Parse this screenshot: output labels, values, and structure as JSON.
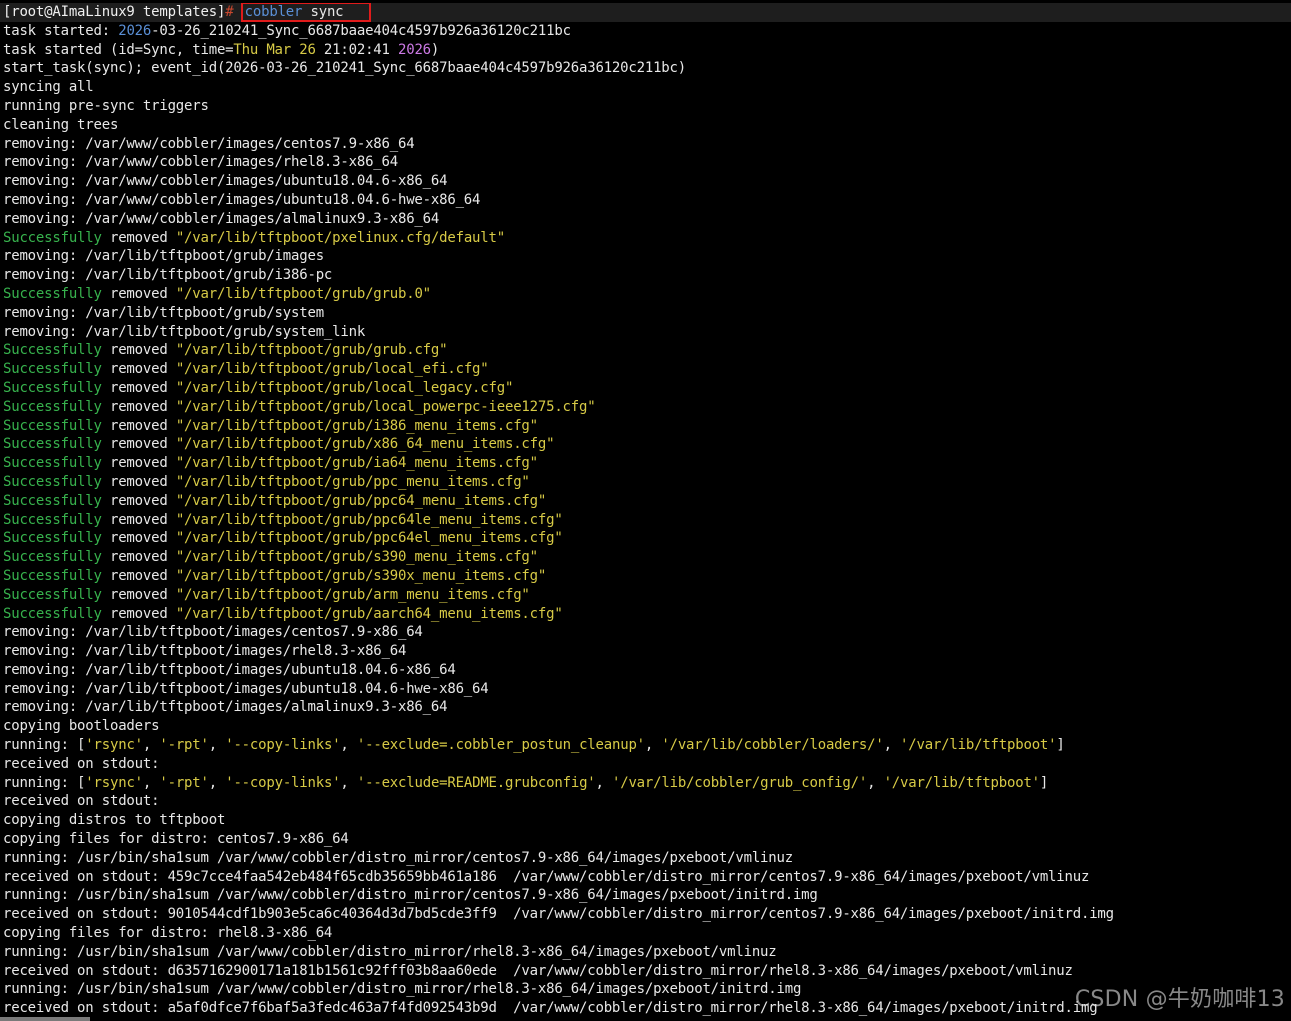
{
  "terminal": {
    "lines": [
      [
        {
          "t": "[root@AImaLinux9 templates]",
          "c": "p"
        },
        {
          "t": "# ",
          "c": "r"
        },
        {
          "t": "cobbler",
          "c": "b",
          "box": true
        },
        {
          "t": " sync",
          "c": "w",
          "box": true
        }
      ],
      [
        {
          "t": "task started",
          "c": "w"
        },
        {
          "t": ": ",
          "c": "w"
        },
        {
          "t": "2026",
          "c": "b"
        },
        {
          "t": "-03-26_210241_Sync_6687baae404c4597b926a36120c211bc",
          "c": "w"
        }
      ],
      [
        {
          "t": "task started (id=Sync, time=",
          "c": "w"
        },
        {
          "t": "Thu Mar 26",
          "c": "y"
        },
        {
          "t": " 21:02:41 ",
          "c": "w"
        },
        {
          "t": "2026",
          "c": "v"
        },
        {
          "t": ")",
          "c": "w"
        }
      ],
      [
        {
          "t": "start_task(sync); event_id(2026-03-26_210241_Sync_6687baae404c4597b926a36120c211bc)",
          "c": "w"
        }
      ],
      [
        {
          "t": "syncing all",
          "c": "w"
        }
      ],
      [
        {
          "t": "running pre-sync triggers",
          "c": "w"
        }
      ],
      [
        {
          "t": "cleaning trees",
          "c": "w"
        }
      ],
      [
        {
          "t": "removing: /var/www/cobbler/images/centos7.9-x86_64",
          "c": "w"
        }
      ],
      [
        {
          "t": "removing: /var/www/cobbler/images/rhel8.3-x86_64",
          "c": "w"
        }
      ],
      [
        {
          "t": "removing: /var/www/cobbler/images/ubuntu18.04.6-x86_64",
          "c": "w"
        }
      ],
      [
        {
          "t": "removing: /var/www/cobbler/images/ubuntu18.04.6-hwe-x86_64",
          "c": "w"
        }
      ],
      [
        {
          "t": "removing: /var/www/cobbler/images/almalinux9.3-x86_64",
          "c": "w"
        }
      ],
      [
        {
          "t": "Successfully",
          "c": "g"
        },
        {
          "t": " removed ",
          "c": "w"
        },
        {
          "t": "\"/var/lib/tftpboot/pxelinux.cfg/default\"",
          "c": "y"
        }
      ],
      [
        {
          "t": "removing: /var/lib/tftpboot/grub/images",
          "c": "w"
        }
      ],
      [
        {
          "t": "removing: /var/lib/tftpboot/grub/i386-pc",
          "c": "w"
        }
      ],
      [
        {
          "t": "Successfully",
          "c": "g"
        },
        {
          "t": " removed ",
          "c": "w"
        },
        {
          "t": "\"/var/lib/tftpboot/grub/grub.0\"",
          "c": "y"
        }
      ],
      [
        {
          "t": "removing: /var/lib/tftpboot/grub/system",
          "c": "w"
        }
      ],
      [
        {
          "t": "removing: /var/lib/tftpboot/grub/system_link",
          "c": "w"
        }
      ],
      [
        {
          "t": "Successfully",
          "c": "g"
        },
        {
          "t": " removed ",
          "c": "w"
        },
        {
          "t": "\"/var/lib/tftpboot/grub/grub.cfg\"",
          "c": "y"
        }
      ],
      [
        {
          "t": "Successfully",
          "c": "g"
        },
        {
          "t": " removed ",
          "c": "w"
        },
        {
          "t": "\"/var/lib/tftpboot/grub/local_efi.cfg\"",
          "c": "y"
        }
      ],
      [
        {
          "t": "Successfully",
          "c": "g"
        },
        {
          "t": " removed ",
          "c": "w"
        },
        {
          "t": "\"/var/lib/tftpboot/grub/local_legacy.cfg\"",
          "c": "y"
        }
      ],
      [
        {
          "t": "Successfully",
          "c": "g"
        },
        {
          "t": " removed ",
          "c": "w"
        },
        {
          "t": "\"/var/lib/tftpboot/grub/local_powerpc-ieee1275.cfg\"",
          "c": "y"
        }
      ],
      [
        {
          "t": "Successfully",
          "c": "g"
        },
        {
          "t": " removed ",
          "c": "w"
        },
        {
          "t": "\"/var/lib/tftpboot/grub/i386_menu_items.cfg\"",
          "c": "y"
        }
      ],
      [
        {
          "t": "Successfully",
          "c": "g"
        },
        {
          "t": " removed ",
          "c": "w"
        },
        {
          "t": "\"/var/lib/tftpboot/grub/x86_64_menu_items.cfg\"",
          "c": "y"
        }
      ],
      [
        {
          "t": "Successfully",
          "c": "g"
        },
        {
          "t": " removed ",
          "c": "w"
        },
        {
          "t": "\"/var/lib/tftpboot/grub/ia64_menu_items.cfg\"",
          "c": "y"
        }
      ],
      [
        {
          "t": "Successfully",
          "c": "g"
        },
        {
          "t": " removed ",
          "c": "w"
        },
        {
          "t": "\"/var/lib/tftpboot/grub/ppc_menu_items.cfg\"",
          "c": "y"
        }
      ],
      [
        {
          "t": "Successfully",
          "c": "g"
        },
        {
          "t": " removed ",
          "c": "w"
        },
        {
          "t": "\"/var/lib/tftpboot/grub/ppc64_menu_items.cfg\"",
          "c": "y"
        }
      ],
      [
        {
          "t": "Successfully",
          "c": "g"
        },
        {
          "t": " removed ",
          "c": "w"
        },
        {
          "t": "\"/var/lib/tftpboot/grub/ppc64le_menu_items.cfg\"",
          "c": "y"
        }
      ],
      [
        {
          "t": "Successfully",
          "c": "g"
        },
        {
          "t": " removed ",
          "c": "w"
        },
        {
          "t": "\"/var/lib/tftpboot/grub/ppc64el_menu_items.cfg\"",
          "c": "y"
        }
      ],
      [
        {
          "t": "Successfully",
          "c": "g"
        },
        {
          "t": " removed ",
          "c": "w"
        },
        {
          "t": "\"/var/lib/tftpboot/grub/s390_menu_items.cfg\"",
          "c": "y"
        }
      ],
      [
        {
          "t": "Successfully",
          "c": "g"
        },
        {
          "t": " removed ",
          "c": "w"
        },
        {
          "t": "\"/var/lib/tftpboot/grub/s390x_menu_items.cfg\"",
          "c": "y"
        }
      ],
      [
        {
          "t": "Successfully",
          "c": "g"
        },
        {
          "t": " removed ",
          "c": "w"
        },
        {
          "t": "\"/var/lib/tftpboot/grub/arm_menu_items.cfg\"",
          "c": "y"
        }
      ],
      [
        {
          "t": "Successfully",
          "c": "g"
        },
        {
          "t": " removed ",
          "c": "w"
        },
        {
          "t": "\"/var/lib/tftpboot/grub/aarch64_menu_items.cfg\"",
          "c": "y"
        }
      ],
      [
        {
          "t": "removing: /var/lib/tftpboot/images/centos7.9-x86_64",
          "c": "w"
        }
      ],
      [
        {
          "t": "removing: /var/lib/tftpboot/images/rhel8.3-x86_64",
          "c": "w"
        }
      ],
      [
        {
          "t": "removing: /var/lib/tftpboot/images/ubuntu18.04.6-x86_64",
          "c": "w"
        }
      ],
      [
        {
          "t": "removing: /var/lib/tftpboot/images/ubuntu18.04.6-hwe-x86_64",
          "c": "w"
        }
      ],
      [
        {
          "t": "removing: /var/lib/tftpboot/images/almalinux9.3-x86_64",
          "c": "w"
        }
      ],
      [
        {
          "t": "copying bootloaders",
          "c": "w"
        }
      ],
      [
        {
          "t": "running: [",
          "c": "w"
        },
        {
          "t": "'rsync'",
          "c": "y"
        },
        {
          "t": ", ",
          "c": "w"
        },
        {
          "t": "'-rpt'",
          "c": "y"
        },
        {
          "t": ", ",
          "c": "w"
        },
        {
          "t": "'--copy-links'",
          "c": "y"
        },
        {
          "t": ", ",
          "c": "w"
        },
        {
          "t": "'--exclude=.cobbler_postun_cleanup'",
          "c": "y"
        },
        {
          "t": ", ",
          "c": "w"
        },
        {
          "t": "'/var/lib/cobbler/loaders/'",
          "c": "y"
        },
        {
          "t": ", ",
          "c": "w"
        },
        {
          "t": "'/var/lib/tftpboot'",
          "c": "y"
        },
        {
          "t": "]",
          "c": "w"
        }
      ],
      [
        {
          "t": "received on stdout:",
          "c": "w"
        }
      ],
      [
        {
          "t": "running: [",
          "c": "w"
        },
        {
          "t": "'rsync'",
          "c": "y"
        },
        {
          "t": ", ",
          "c": "w"
        },
        {
          "t": "'-rpt'",
          "c": "y"
        },
        {
          "t": ", ",
          "c": "w"
        },
        {
          "t": "'--copy-links'",
          "c": "y"
        },
        {
          "t": ", ",
          "c": "w"
        },
        {
          "t": "'--exclude=README.grubconfig'",
          "c": "y"
        },
        {
          "t": ", ",
          "c": "w"
        },
        {
          "t": "'/var/lib/cobbler/grub_config/'",
          "c": "y"
        },
        {
          "t": ", ",
          "c": "w"
        },
        {
          "t": "'/var/lib/tftpboot'",
          "c": "y"
        },
        {
          "t": "]",
          "c": "w"
        }
      ],
      [
        {
          "t": "received on stdout:",
          "c": "w"
        }
      ],
      [
        {
          "t": "copying distros to tftpboot",
          "c": "w"
        }
      ],
      [
        {
          "t": "copying files for distro: centos7.9-x86_64",
          "c": "w"
        }
      ],
      [
        {
          "t": "running: /usr/bin/sha1sum /var/www/cobbler/distro_mirror/centos7.9-x86_64/images/pxeboot/vmlinuz",
          "c": "w"
        }
      ],
      [
        {
          "t": "received on stdout: 459c7cce4faa542eb484f65cdb35659bb461a186  /var/www/cobbler/distro_mirror/centos7.9-x86_64/images/pxeboot/vmlinuz",
          "c": "w"
        }
      ],
      [
        {
          "t": "running: /usr/bin/sha1sum /var/www/cobbler/distro_mirror/centos7.9-x86_64/images/pxeboot/initrd.img",
          "c": "w"
        }
      ],
      [
        {
          "t": "received on stdout: 9010544cdf1b903e5ca6c40364d3d7bd5cde3ff9  /var/www/cobbler/distro_mirror/centos7.9-x86_64/images/pxeboot/initrd.img",
          "c": "w"
        }
      ],
      [
        {
          "t": "copying files for distro: rhel8.3-x86_64",
          "c": "w"
        }
      ],
      [
        {
          "t": "running: /usr/bin/sha1sum /var/www/cobbler/distro_mirror/rhel8.3-x86_64/images/pxeboot/vmlinuz",
          "c": "w"
        }
      ],
      [
        {
          "t": "received on stdout: d6357162900171a181b1561c92fff03b8aa60ede  /var/www/cobbler/distro_mirror/rhel8.3-x86_64/images/pxeboot/vmlinuz",
          "c": "w"
        }
      ],
      [
        {
          "t": "running: /usr/bin/sha1sum /var/www/cobbler/distro_mirror/rhel8.3-x86_64/images/pxeboot/initrd.img",
          "c": "w"
        }
      ],
      [
        {
          "t": "received on stdout: a5af0dfce7f6baf5a3fedc463a7f4fd092543b9d  /var/www/cobbler/distro_mirror/rhel8.3-x86_64/images/pxeboot/initrd.img",
          "c": "w"
        }
      ]
    ]
  },
  "watermark": "CSDN @牛奶咖啡13",
  "colors": {
    "background": "#000000",
    "default_text": "#e8e8e8",
    "prompt_hash": "#c8472e",
    "command": "#5a8fd6",
    "year": "#cd7ae6",
    "success": "#37b24d",
    "quoted_path": "#d7ca46",
    "highlight_box": "#e01b1b"
  }
}
